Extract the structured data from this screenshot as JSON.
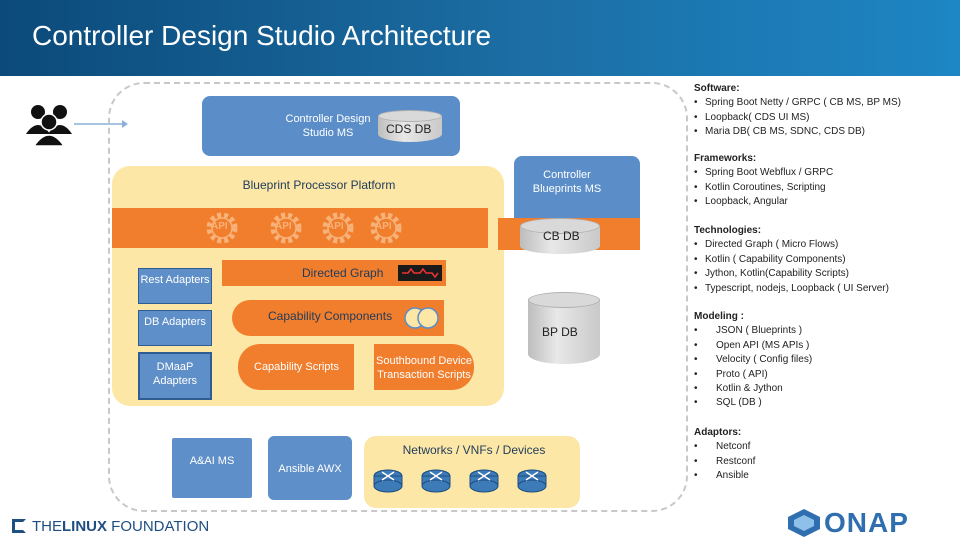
{
  "header": {
    "title": "Controller Design Studio Architecture"
  },
  "diagram": {
    "cds_ms": "Controller Design Studio MS",
    "cds_db": "CDS DB",
    "blueprint_platform": "Blueprint Processor Platform",
    "controller_blueprints_ms": "Controller Blueprints MS",
    "cb_db": "CB DB",
    "bp_db": "BP DB",
    "api_labels": [
      "API",
      "API",
      "API",
      "API"
    ],
    "directed_graph": "Directed Graph",
    "capability_components": "Capability Components",
    "capability_scripts": "Capability Scripts",
    "southbound_scripts": "Southbound Device Transaction Scripts",
    "rest_adapters": "Rest Adapters",
    "db_adapters": "DB Adapters",
    "dmaap_adapters": "DMaaP Adapters",
    "aai_ms": "A&AI MS",
    "ansible_awx": "Ansible AWX",
    "networks": "Networks / VNFs / Devices"
  },
  "sidebar": {
    "software": {
      "title": "Software:",
      "items": [
        "Spring Boot Netty / GRPC ( CB MS, BP MS)",
        "Loopback( CDS UI MS)",
        "Maria DB( CB MS, SDNC, CDS DB)"
      ]
    },
    "frameworks": {
      "title": "Frameworks:",
      "items": [
        "Spring Boot Webflux / GRPC",
        "Kotlin Coroutines, Scripting",
        "Loopback, Angular"
      ]
    },
    "technologies": {
      "title": "Technologies:",
      "items": [
        "Directed Graph ( Micro Flows)",
        "Kotlin ( Capability Components)",
        "Jython, Kotlin(Capability Scripts)",
        "Typescript, nodejs, Loopback ( UI Server)"
      ]
    },
    "modeling": {
      "title": "Modeling :",
      "items": [
        "JSON ( Blueprints )",
        "Open API (MS APIs )",
        "Velocity ( Config files)",
        "Proto ( API)",
        "Kotlin & Jython",
        "SQL (DB )"
      ]
    },
    "adaptors": {
      "title": "Adaptors:",
      "items": [
        "Netconf",
        "Restconf",
        "Ansible"
      ]
    }
  },
  "footer": {
    "linux_the": "THE",
    "linux_bold": "LINUX",
    "linux_rest": " FOUNDATION",
    "onap": "ONAP"
  },
  "colors": {
    "header": "#1c6ea4",
    "blue_box": "#5b8ec9",
    "orange": "#f07e2c",
    "tan": "#fde7a6"
  }
}
